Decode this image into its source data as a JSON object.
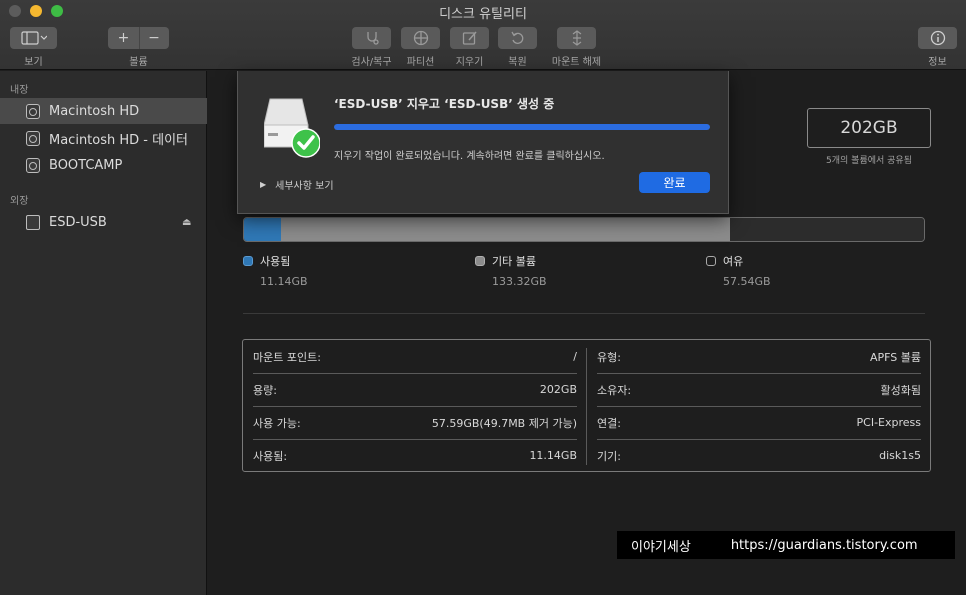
{
  "window": {
    "title": "디스크 유틸리티"
  },
  "toolbar": {
    "view_label": "보기",
    "add_icon": "plus-icon",
    "remove_icon": "minus-icon",
    "volume_label": "볼륨",
    "first_aid_label": "검사/복구",
    "partition_label": "파티션",
    "erase_label": "지우기",
    "restore_label": "복원",
    "unmount_label": "마운트 해제",
    "info_label": "정보"
  },
  "sidebar": {
    "internal_heading": "내장",
    "internal_items": [
      {
        "label": "Macintosh HD",
        "selected": true
      },
      {
        "label": "Macintosh HD - 데이터",
        "selected": false
      },
      {
        "label": "BOOTCAMP",
        "selected": false
      }
    ],
    "external_heading": "외장",
    "external_items": [
      {
        "label": "ESD-USB",
        "eject_icon": "eject-icon"
      }
    ]
  },
  "volume": {
    "capacity": "202GB",
    "shared_text": "5개의 볼륨에서 공유됨"
  },
  "usage": {
    "segments": [
      {
        "name": "사용됨",
        "value": "11.14GB",
        "fraction": 0.055,
        "color": "#2f78b6"
      },
      {
        "name": "기타 볼륨",
        "value": "133.32GB",
        "fraction": 0.66,
        "color": "#8c8c8c"
      },
      {
        "name": "여유",
        "value": "57.54GB",
        "fraction": 0.285,
        "color": "#2c2c2c"
      }
    ]
  },
  "info": {
    "left": [
      {
        "label": "마운트 포인트:",
        "value": "/"
      },
      {
        "label": "용량:",
        "value": "202GB"
      },
      {
        "label": "사용 가능:",
        "value": "57.59GB(49.7MB 제거 가능)"
      },
      {
        "label": "사용됨:",
        "value": "11.14GB"
      }
    ],
    "right": [
      {
        "label": "유형:",
        "value": "APFS 볼륨"
      },
      {
        "label": "소유자:",
        "value": "활성화됨"
      },
      {
        "label": "연결:",
        "value": "PCI-Express"
      },
      {
        "label": "기기:",
        "value": "disk1s5"
      }
    ]
  },
  "sheet": {
    "title": "‘ESD-USB’ 지우고 ‘ESD-USB’ 생성 중",
    "progress": 1.0,
    "message": "지우기 작업이 완료되었습니다. 계속하려면 완료를 클릭하십시오.",
    "details_label": "세부사항 보기",
    "done_label": "완료"
  },
  "watermark": {
    "name": "이야기세상",
    "url": "https://guardians.tistory.com"
  },
  "colors": {
    "accent": "#1f6be3",
    "used": "#2f78b6",
    "other": "#8c8c8c",
    "check": "#3ec24a"
  }
}
